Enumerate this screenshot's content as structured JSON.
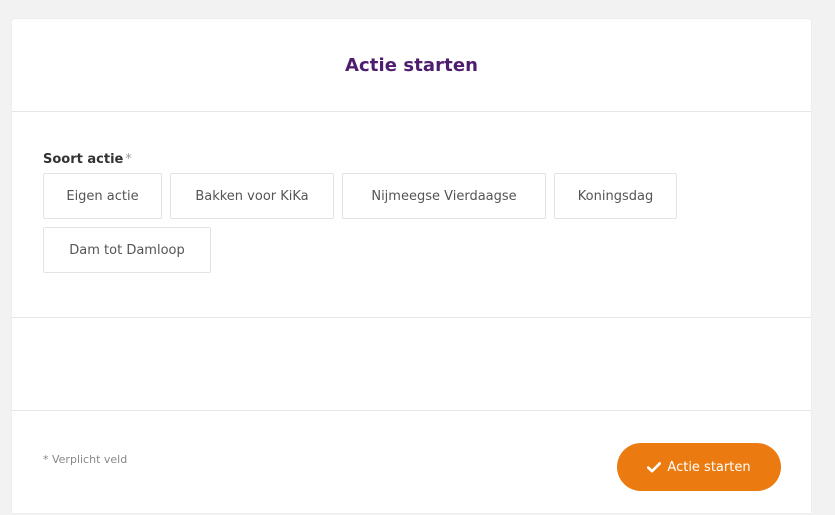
{
  "header": {
    "title": "Actie starten"
  },
  "form": {
    "field_label": "Soort actie",
    "required_mark": "*",
    "options": [
      {
        "label": "Eigen actie"
      },
      {
        "label": "Bakken voor KiKa"
      },
      {
        "label": "Nijmeegse Vierdaagse"
      },
      {
        "label": "Koningsdag"
      },
      {
        "label": "Dam tot Damloop"
      }
    ]
  },
  "footer": {
    "required_note": "* Verplicht veld",
    "submit_label": "Actie starten",
    "submit_icon": "check-icon"
  },
  "colors": {
    "title": "#4e1d6e",
    "accent": "#eb7b10"
  }
}
